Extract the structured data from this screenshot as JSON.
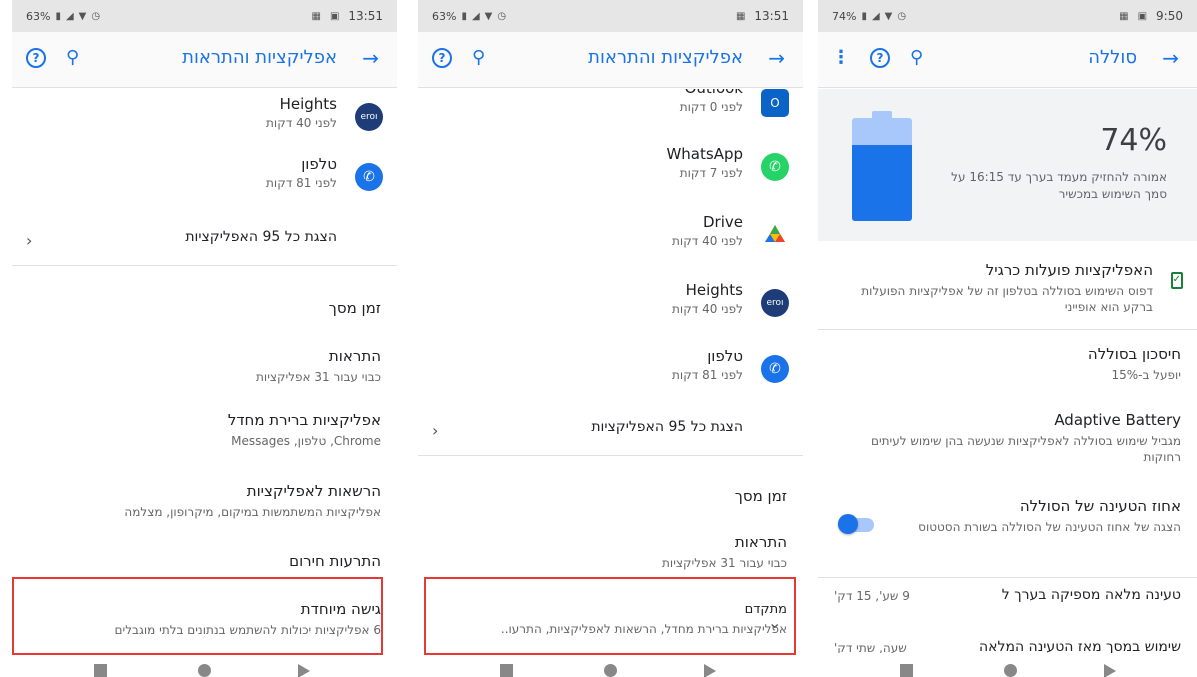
{
  "panel1": {
    "status": {
      "battery": "63%",
      "time": "13:51"
    },
    "app_bar": {
      "title": "אפליקציות והתראות"
    },
    "recent_apps": [
      {
        "name": "Heights",
        "time": "לפני 40 דקות",
        "icon": "heights-icon"
      },
      {
        "name": "טלפון",
        "time": "לפני 81 דקות",
        "icon": "phone-icon"
      }
    ],
    "see_all": "הצגת כל 95 האפליקציות",
    "items": [
      {
        "title": "זמן מסך",
        "subtitle": ""
      },
      {
        "title": "התראות",
        "subtitle": "כבוי עבור 31 אפליקציות"
      },
      {
        "title": "אפליקציות ברירת מחדל",
        "subtitle": "Chrome, טלפון, Messages"
      },
      {
        "title": "הרשאות לאפליקציות",
        "subtitle": "אפליקציות המשתמשות במיקום, מיקרופון, מצלמה"
      },
      {
        "title": "התרעות חירום",
        "subtitle": ""
      },
      {
        "title": "גישה מיוחדת",
        "subtitle": "6 אפליקציות יכולות להשתמש בנתונים בלתי מוגבלים"
      }
    ]
  },
  "panel2": {
    "status": {
      "battery": "63%",
      "time": "13:51"
    },
    "app_bar": {
      "title": "אפליקציות והתראות"
    },
    "recent_apps": [
      {
        "name": "Outlook",
        "time": "לפני 0 דקות",
        "icon": "outlook-icon"
      },
      {
        "name": "WhatsApp",
        "time": "לפני 7 דקות",
        "icon": "whatsapp-icon"
      },
      {
        "name": "Drive",
        "time": "לפני 40 דקות",
        "icon": "drive-icon"
      },
      {
        "name": "Heights",
        "time": "לפני 40 דקות",
        "icon": "heights-icon"
      },
      {
        "name": "טלפון",
        "time": "לפני 81 דקות",
        "icon": "phone-icon"
      }
    ],
    "see_all": "הצגת כל 95 האפליקציות",
    "items": [
      {
        "title": "זמן מסך",
        "subtitle": ""
      },
      {
        "title": "התראות",
        "subtitle": "כבוי עבור 31 אפליקציות"
      },
      {
        "title": "מתקדם",
        "subtitle": "אפליקציות ברירת מחדל, הרשאות לאפליקציות, התרעו.."
      }
    ]
  },
  "panel3": {
    "status": {
      "battery": "74%",
      "time": "9:50"
    },
    "app_bar": {
      "title": "סוללה"
    },
    "battery": {
      "percent_label": "74%",
      "level": 0.74,
      "estimate": "אמורה להחזיק מעמד בערך עד 16:15 על סמך השימוש במכשיר"
    },
    "items": [
      {
        "title": "האפליקציות פועלות כרגיל",
        "subtitle": "דפוס השימוש בסוללה בטלפון זה של אפליקציות הפועלות ברקע הוא אופייני"
      },
      {
        "title": "חיסכון בסוללה",
        "subtitle": "יופעל ב-15%"
      },
      {
        "title": "Adaptive Battery",
        "subtitle": "מגביל שימוש בסוללה לאפליקציות שנעשה בהן שימוש לעיתים רחוקות"
      },
      {
        "title": "אחוז הטעינה של הסוללה",
        "subtitle": "הצגה של אחוז הטעינה של הסוללה בשורת הסטטוס"
      }
    ],
    "toggle_on": true,
    "stats": [
      {
        "label": "טעינה מלאה מספיקה בערך ל",
        "value": "9 שע', 15 דק'"
      },
      {
        "label": "שימוש במסך מאז הטעינה המלאה",
        "value": "שעה, שתי דק'"
      }
    ]
  },
  "colors": {
    "accent": "#1a73e8",
    "highlight": "#e53935",
    "whatsapp": "#25d366",
    "outlook": "#0a64c8",
    "phone": "#1a73e8",
    "heights": "#1d3c78"
  }
}
